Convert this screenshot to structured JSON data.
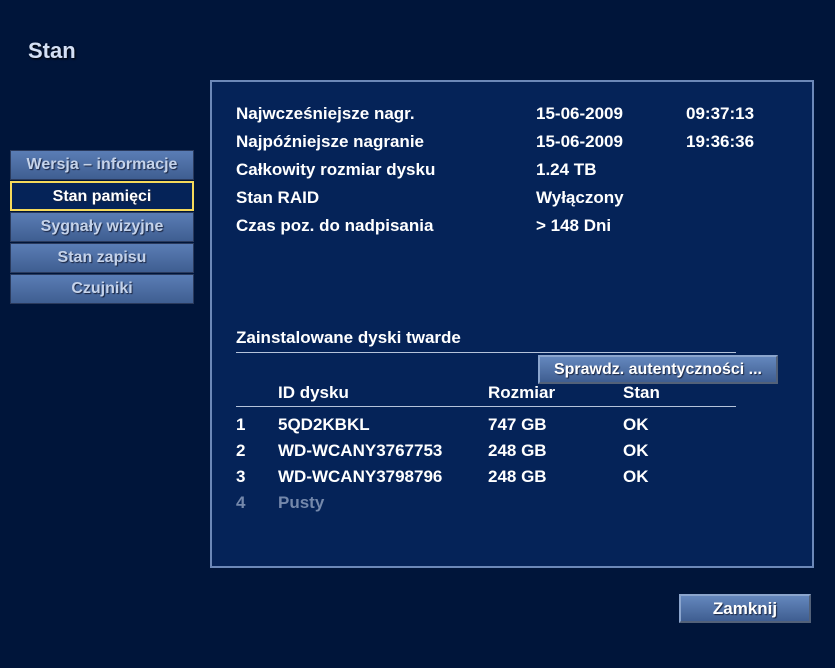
{
  "page_title": "Stan",
  "sidebar": {
    "items": [
      {
        "label": "Wersja – informacje",
        "active": false
      },
      {
        "label": "Stan pamięci",
        "active": true
      },
      {
        "label": "Sygnały wizyjne",
        "active": false
      },
      {
        "label": "Stan zapisu",
        "active": false
      },
      {
        "label": "Czujniki",
        "active": false
      }
    ]
  },
  "info": {
    "earliest": {
      "label": "Najwcześniejsze nagr.",
      "date": "15-06-2009",
      "time": "09:37:13"
    },
    "latest": {
      "label": "Najpóźniejsze nagranie",
      "date": "15-06-2009",
      "time": "19:36:36"
    },
    "total_size": {
      "label": "Całkowity rozmiar dysku",
      "value": "1.24 TB"
    },
    "raid": {
      "label": "Stan RAID",
      "value": "Wyłączony"
    },
    "overwrite": {
      "label": "Czas poz. do nadpisania",
      "value": "> 148 Dni"
    }
  },
  "auth_button": "Sprawdz. autentyczności ...",
  "disk_section": {
    "title": "Zainstalowane dyski twarde",
    "headers": {
      "id": "ID dysku",
      "size": "Rozmiar",
      "status": "Stan"
    },
    "rows": [
      {
        "num": "1",
        "id": "5QD2KBKL",
        "size": "747 GB",
        "status": "OK",
        "empty": false
      },
      {
        "num": "2",
        "id": "WD-WCANY3767753",
        "size": "248 GB",
        "status": "OK",
        "empty": false
      },
      {
        "num": "3",
        "id": "WD-WCANY3798796",
        "size": "248 GB",
        "status": "OK",
        "empty": false
      },
      {
        "num": "4",
        "id": "Pusty",
        "size": "",
        "status": "",
        "empty": true
      }
    ]
  },
  "close_button": "Zamknij"
}
